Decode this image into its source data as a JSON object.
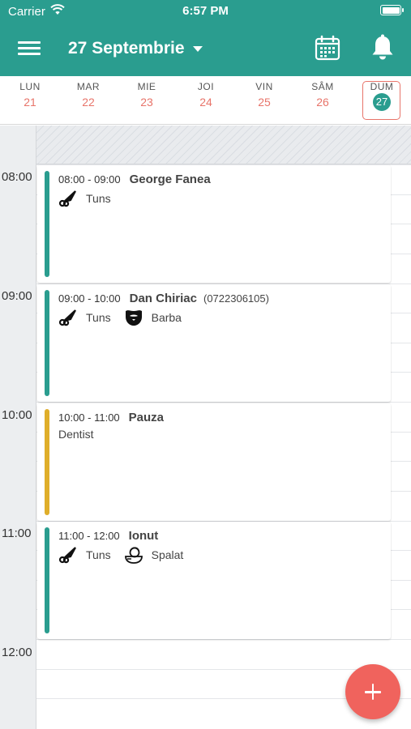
{
  "status_bar": {
    "carrier": "Carrier",
    "time": "6:57 PM"
  },
  "header": {
    "date_label": "27 Septembrie",
    "bg_color": "#2a9d8f"
  },
  "week": [
    {
      "name": "LUN",
      "num": "21",
      "selected": false
    },
    {
      "name": "MAR",
      "num": "22",
      "selected": false
    },
    {
      "name": "MIE",
      "num": "23",
      "selected": false
    },
    {
      "name": "JOI",
      "num": "24",
      "selected": false
    },
    {
      "name": "VIN",
      "num": "25",
      "selected": false
    },
    {
      "name": "SÂM",
      "num": "26",
      "selected": false
    },
    {
      "name": "DUM",
      "num": "27",
      "selected": true
    }
  ],
  "hours": [
    "08:00",
    "09:00",
    "10:00",
    "11:00",
    "12:00"
  ],
  "events": [
    {
      "range": "08:00 - 09:00",
      "name": "George Fanea",
      "phone": "",
      "color": "#2a9d8f",
      "services": [
        {
          "icon": "scissors-icon",
          "label": "Tuns"
        }
      ]
    },
    {
      "range": "09:00 - 10:00",
      "name": "Dan Chiriac",
      "phone": "(0722306105)",
      "color": "#2a9d8f",
      "services": [
        {
          "icon": "scissors-icon",
          "label": "Tuns"
        },
        {
          "icon": "beard-icon",
          "label": "Barba"
        }
      ]
    },
    {
      "range": "10:00 - 11:00",
      "name": "Pauza",
      "phone": "",
      "color": "#dfae2a",
      "note": "Dentist",
      "services": []
    },
    {
      "range": "11:00 - 12:00",
      "name": "Ionut",
      "phone": "",
      "color": "#2a9d8f",
      "services": [
        {
          "icon": "scissors-icon",
          "label": "Tuns"
        },
        {
          "icon": "hair-wash-icon",
          "label": "Spalat"
        }
      ]
    }
  ],
  "fab": {
    "icon": "plus-icon",
    "color": "#f0635d"
  }
}
